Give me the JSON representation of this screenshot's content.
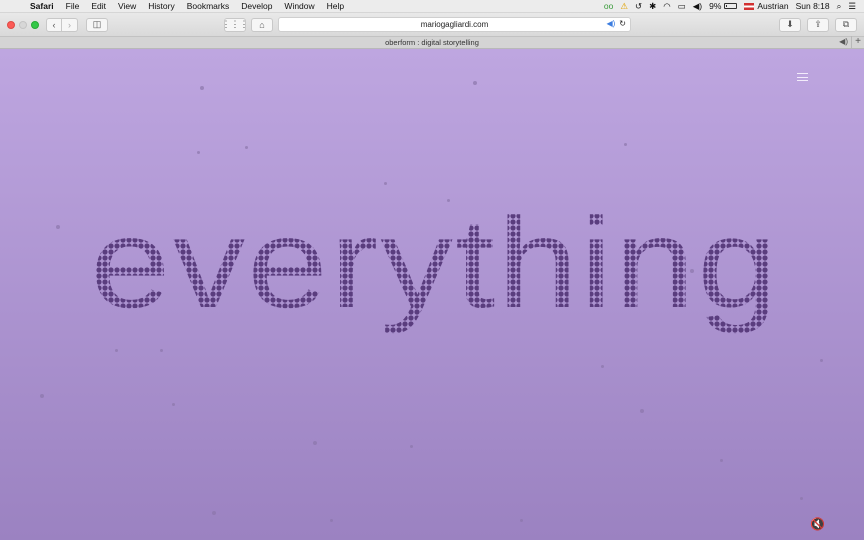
{
  "menubar": {
    "apple_icon": "apple-icon",
    "app_name": "Safari",
    "items": [
      "File",
      "Edit",
      "View",
      "History",
      "Bookmarks",
      "Develop",
      "Window",
      "Help"
    ],
    "status": {
      "battery_percent": "9%",
      "input_source": "Austrian",
      "clock": "Sun 8:18"
    }
  },
  "toolbar": {
    "url": "mariogagliardi.com"
  },
  "tab": {
    "title": "oberform : digital storytelling"
  },
  "page": {
    "headline": "everything",
    "dot_color": "#5a3d7e",
    "background_top": "#bea6e0",
    "background_bottom": "#9b82c1"
  }
}
